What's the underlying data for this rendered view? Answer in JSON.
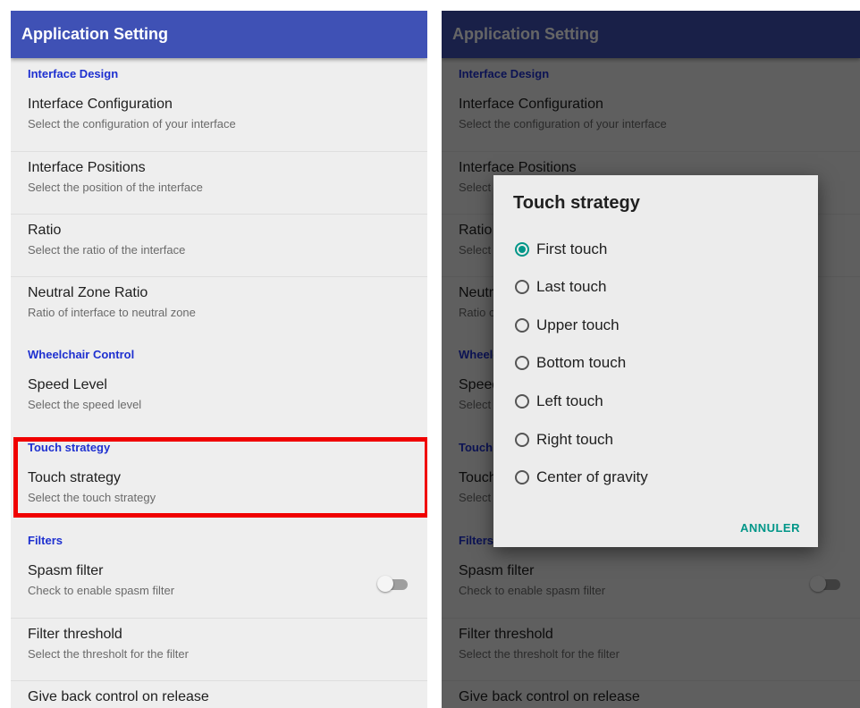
{
  "app_bar": {
    "title": "Application Setting"
  },
  "settings": {
    "interface_design": {
      "header": "Interface Design",
      "configuration": {
        "title": "Interface Configuration",
        "summary": "Select the configuration of your interface"
      },
      "positions": {
        "title": "Interface Positions",
        "summary": "Select the position of the interface"
      },
      "ratio": {
        "title": "Ratio",
        "summary": "Select the ratio of the interface"
      },
      "neutral_zone": {
        "title": "Neutral Zone Ratio",
        "summary": "Ratio of interface to neutral zone"
      }
    },
    "wheelchair_control": {
      "header": "Wheelchair Control",
      "speed_level": {
        "title": "Speed Level",
        "summary": "Select the speed level"
      }
    },
    "touch_strategy": {
      "header": "Touch strategy",
      "item": {
        "title": "Touch strategy",
        "summary": "Select the touch strategy"
      }
    },
    "filters": {
      "header": "Filters",
      "spasm_filter": {
        "title": "Spasm filter",
        "summary": "Check to enable spasm filter",
        "enabled": false
      },
      "filter_threshold": {
        "title": "Filter threshold",
        "summary": "Select the thresholt for the filter"
      },
      "give_back": {
        "title": "Give back control on release"
      }
    }
  },
  "dialog": {
    "title": "Touch strategy",
    "options": [
      {
        "label": "First touch",
        "selected": true
      },
      {
        "label": "Last touch",
        "selected": false
      },
      {
        "label": "Upper touch",
        "selected": false
      },
      {
        "label": "Bottom touch",
        "selected": false
      },
      {
        "label": "Left touch",
        "selected": false
      },
      {
        "label": "Right touch",
        "selected": false
      },
      {
        "label": "Center of gravity",
        "selected": false
      }
    ],
    "cancel_label": "ANNULER"
  },
  "colors": {
    "app_bar": "#3f51b5",
    "category_header": "#1e30d0",
    "radio_accent": "#009688",
    "highlight_border": "#f00000"
  }
}
